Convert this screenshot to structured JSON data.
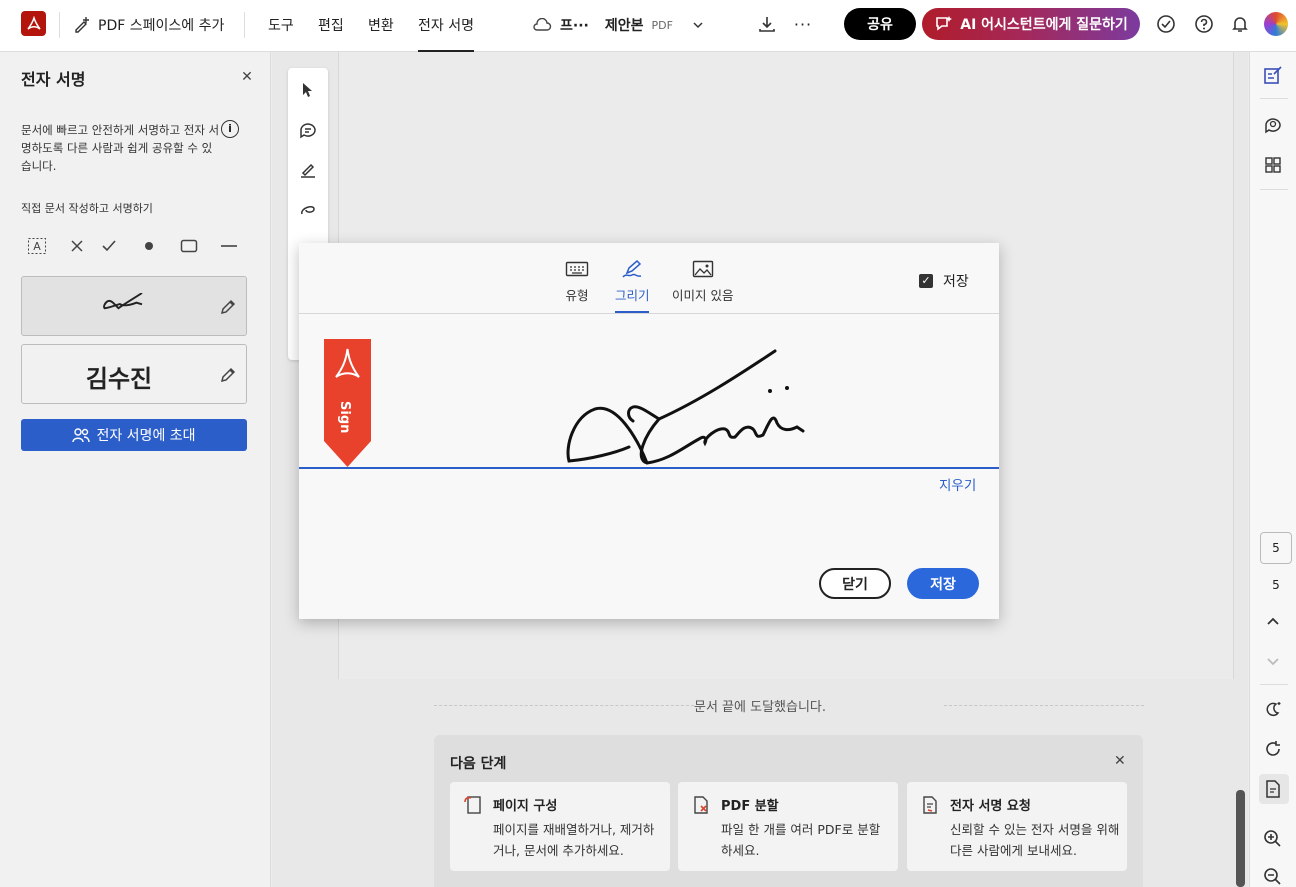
{
  "header": {
    "add_space_label": "PDF 스페이스에 추가",
    "menu": [
      "도구",
      "편집",
      "변환",
      "전자 서명"
    ],
    "active_menu": "전자 서명",
    "doc_title_short": "프···",
    "doc_name": "제안본",
    "doc_type": "PDF",
    "share_label": "공유",
    "ai_label": "AI 어시스턴트에게 질문하기"
  },
  "left_panel": {
    "title": "전자 서명",
    "description": "문서에 빠르고 안전하게 서명하고 전자 서명하도록 다른 사람과 쉽게 공유할 수 있습니다.",
    "subheading": "직접 문서 작성하고 서명하기",
    "tools": [
      "text-field-icon",
      "cross-mark-icon",
      "checkmark-icon",
      "dot-icon",
      "rectangle-icon",
      "line-icon"
    ],
    "initials_name": "김수진",
    "invite_label": "전자 서명에 초대"
  },
  "dialog": {
    "tabs": [
      {
        "label": "유형",
        "icon": "keyboard-icon"
      },
      {
        "label": "그리기",
        "icon": "pen-draw-icon"
      },
      {
        "label": "이미지 있음",
        "icon": "image-icon"
      }
    ],
    "active_tab": "그리기",
    "save_checkbox_label": "저장",
    "save_checked": true,
    "bookmark_text": "Sign",
    "clear_label": "지우기",
    "close_label": "닫기",
    "save_label": "저장",
    "accent_color": "#2b5ec9"
  },
  "document": {
    "end_note": "문서 끝에 도달했습니다.",
    "page_current": "5",
    "page_total": "5"
  },
  "next_steps": {
    "title": "다음 단계",
    "cards": [
      {
        "title": "페이지 구성",
        "desc": "페이지를 재배열하거나, 제거하거나, 문서에 추가하세요.",
        "icon": "page-organize-icon"
      },
      {
        "title": "PDF 분할",
        "desc": "파일 한 개를 여러 PDF로 분할하세요.",
        "icon": "split-pdf-icon"
      },
      {
        "title": "전자 서명 요청",
        "desc": "신뢰할 수 있는 전자 서명을 위해 다른 사람에게 보내세요.",
        "icon": "request-signature-icon"
      }
    ]
  }
}
